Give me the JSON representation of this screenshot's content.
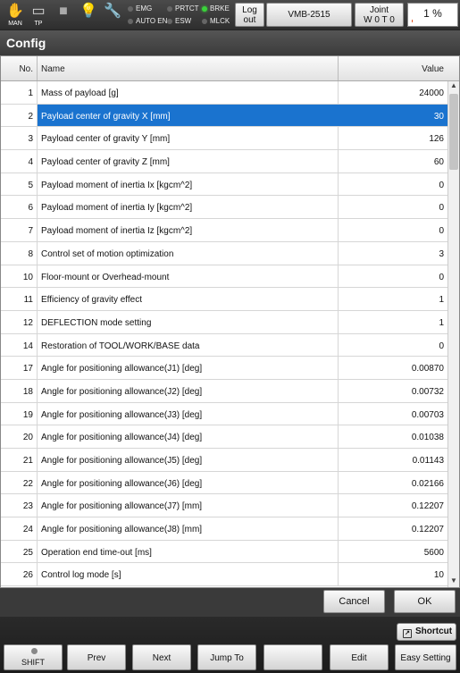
{
  "status": {
    "man_label": "MAN",
    "tp_label": "TP",
    "indicators": [
      {
        "label": "EMG",
        "on": false
      },
      {
        "label": "AUTO EN",
        "on": false
      },
      {
        "label": "PRTCT",
        "on": false
      },
      {
        "label": "ESW",
        "on": false
      },
      {
        "label": "BRKE",
        "on": true
      },
      {
        "label": "MLCK",
        "on": false
      }
    ],
    "logout_line1": "Log",
    "logout_line2": "out",
    "robot_model": "VMB-2515",
    "joint_line1": "Joint",
    "joint_line2": "W 0 T 0",
    "speed": "1 %",
    "speed_fraction": 0.01
  },
  "title": "Config",
  "table": {
    "headers": {
      "no": "No.",
      "name": "Name",
      "value": "Value"
    },
    "rows": [
      {
        "no": "1",
        "name": "Mass of payload [g]",
        "value": "24000"
      },
      {
        "no": "2",
        "name": "Payload center of gravity X [mm]",
        "value": "30"
      },
      {
        "no": "3",
        "name": "Payload center of gravity Y [mm]",
        "value": "126"
      },
      {
        "no": "4",
        "name": "Payload center of gravity Z [mm]",
        "value": "60"
      },
      {
        "no": "5",
        "name": "Payload moment of inertia Ix [kgcm^2]",
        "value": "0"
      },
      {
        "no": "6",
        "name": "Payload moment of inertia Iy [kgcm^2]",
        "value": "0"
      },
      {
        "no": "7",
        "name": "Payload moment of inertia Iz [kgcm^2]",
        "value": "0"
      },
      {
        "no": "8",
        "name": "Control set of motion optimization",
        "value": "3"
      },
      {
        "no": "10",
        "name": "Floor-mount or Overhead-mount",
        "value": "0"
      },
      {
        "no": "11",
        "name": "Efficiency of gravity effect",
        "value": "1"
      },
      {
        "no": "12",
        "name": "DEFLECTION mode setting",
        "value": "1"
      },
      {
        "no": "14",
        "name": "Restoration of TOOL/WORK/BASE data",
        "value": "0"
      },
      {
        "no": "17",
        "name": "Angle for positioning allowance(J1) [deg]",
        "value": "0.00870"
      },
      {
        "no": "18",
        "name": "Angle for positioning allowance(J2) [deg]",
        "value": "0.00732"
      },
      {
        "no": "19",
        "name": "Angle for positioning allowance(J3) [deg]",
        "value": "0.00703"
      },
      {
        "no": "20",
        "name": "Angle for positioning allowance(J4) [deg]",
        "value": "0.01038"
      },
      {
        "no": "21",
        "name": "Angle for positioning allowance(J5) [deg]",
        "value": "0.01143"
      },
      {
        "no": "22",
        "name": "Angle for positioning allowance(J6) [deg]",
        "value": "0.02166"
      },
      {
        "no": "23",
        "name": "Angle for positioning allowance(J7) [mm]",
        "value": "0.12207"
      },
      {
        "no": "24",
        "name": "Angle for positioning allowance(J8) [mm]",
        "value": "0.12207"
      },
      {
        "no": "25",
        "name": "Operation end time-out  [ms]",
        "value": "5600"
      },
      {
        "no": "26",
        "name": "Control log mode [s]",
        "value": "10"
      }
    ],
    "selected_row": 1
  },
  "dialog": {
    "cancel": "Cancel",
    "ok": "OK"
  },
  "bottom": {
    "shortcut": "Shortcut",
    "fkeys": [
      "SHIFT",
      "Prev",
      "Next",
      "Jump To",
      "",
      "Edit",
      "Easy Setting"
    ]
  },
  "colors": {
    "selection": "#1a73cf",
    "brake_led": "#3ad23a"
  }
}
